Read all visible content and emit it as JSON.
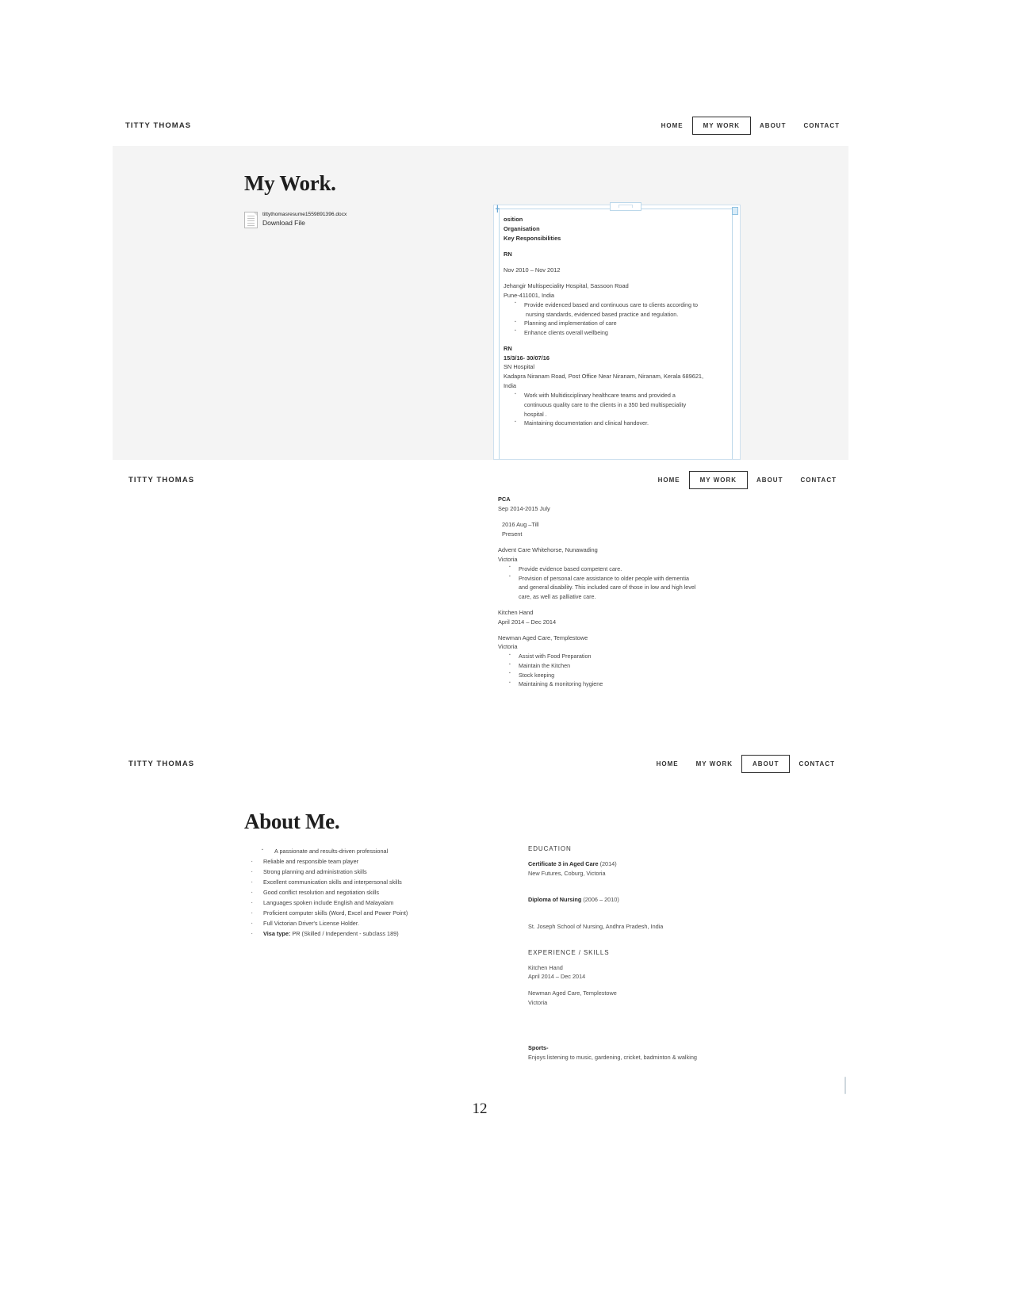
{
  "page": {
    "number": "12"
  },
  "site": {
    "brand": "TITTY THOMAS",
    "nav": [
      {
        "label": "HOME"
      },
      {
        "label": "MY WORK"
      },
      {
        "label": "ABOUT"
      },
      {
        "label": "CONTACT"
      }
    ]
  },
  "section_mywork": {
    "title": "My Work.",
    "file": {
      "name": "tittythomasresume1559891396.docx",
      "action": "Download File",
      "icon": "document-icon"
    },
    "document": {
      "lines": [
        {
          "text": "osition",
          "bold": true
        },
        {
          "text": "Organisation",
          "bold": true
        },
        {
          "text": "Key Responsibilities",
          "bold": true
        },
        {
          "gap": true
        },
        {
          "text": "RN",
          "bold": true
        },
        {
          "gap": true
        },
        {
          "text": "Nov 2010 – Nov 2012"
        },
        {
          "gap": true
        },
        {
          "text": "Jehangir Multispeciality Hospital, Sassoon Road"
        },
        {
          "text": "Pune-411001, India"
        }
      ],
      "bullets_1": [
        "Provide evidenced based and continuous care to clients according to",
        "nursing standards, evidenced based practice and regulation.",
        "Planning and implementation of care",
        "Enhance clients overall wellbeing"
      ],
      "bullets_1_items": [
        {
          "l1": "Provide evidenced based and continuous care to clients according to",
          "l2": "nursing standards, evidenced based practice and regulation."
        },
        {
          "l1": "Planning and implementation of care",
          "l2": ""
        },
        {
          "l1": "Enhance clients overall wellbeing",
          "l2": ""
        }
      ],
      "lines_2": [
        {
          "text": "RN",
          "bold": true
        },
        {
          "text": "15/3/16- 30/07/16",
          "bold": true
        },
        {
          "text": "SN Hospital"
        },
        {
          "text": "Kadapra Niranam Road, Post Office Near Niranam, Niranam, Kerala 689621,"
        },
        {
          "text": "India"
        }
      ],
      "bullets_2_items": [
        {
          "l1": "Work with Multidisciplinary healthcare teams and provided a",
          "l2": "continuous quality care to the clients in a 350 bed multispeciality",
          "l3": "hospital ."
        },
        {
          "l1": "Maintaining documentation and clinical handover.",
          "l2": "",
          "l3": ""
        }
      ]
    }
  },
  "section_work2": {
    "lines": [
      {
        "text": "PCA",
        "bold": true
      },
      {
        "text": "Sep 2014-2015 July"
      },
      {
        "gap": true
      },
      {
        "text": "2016 Aug –Till",
        "indent": true
      },
      {
        "text": "Present",
        "indent": true
      },
      {
        "gap": true
      },
      {
        "text": "Advent Care Whitehorse, Nunawading"
      },
      {
        "text": "Victoria"
      }
    ],
    "bullets_1_items": [
      {
        "l1": "Provide evidence based competent care.",
        "l2": "",
        "l3": ""
      },
      {
        "l1": "Provision of personal care assistance to older people with dementia",
        "l2": "and general disability. This included care of those in low and high level",
        "l3": "care, as well as palliative care."
      }
    ],
    "lines_2": [
      {
        "text": "Kitchen Hand"
      },
      {
        "text": "April  2014 – Dec 2014"
      },
      {
        "gap": true
      },
      {
        "text": "Newman Aged Care, Templestowe"
      },
      {
        "text": "Victoria"
      }
    ],
    "bullets_2_items": [
      "Assist with Food Preparation",
      "Maintain the Kitchen",
      "Stock keeping",
      "Maintaining & monitoring hygiene"
    ]
  },
  "section_about": {
    "title": "About Me.",
    "skills": [
      {
        "text": "A passionate and results-driven professional",
        "first": true
      },
      {
        "text": "Reliable and responsible team player"
      },
      {
        "text": "Strong planning and administration skills"
      },
      {
        "text": "Excellent communication skills and interpersonal skills"
      },
      {
        "text": "Good conflict resolution and negotiation skills"
      },
      {
        "text": "Languages spoken include English and Malayalam"
      },
      {
        "text": "Proficient computer skills (Word, Excel and Power Point)"
      },
      {
        "text": "Full Victorian Driver's License Holder."
      }
    ],
    "visa": {
      "label": "Visa type:",
      "value": " PR (Skilled / Independent - subclass 189)"
    },
    "education": {
      "heading": "EDUCATION",
      "items": [
        {
          "title": "Certificate 3 in Aged Care",
          "year": " (2014)",
          "detail": "New Futures, Coburg, Victoria"
        },
        {
          "title": "Diploma of Nursing",
          "year": " (2006 – 2010)",
          "detail": "St. Joseph School of Nursing, Andhra Pradesh, India"
        }
      ]
    },
    "experience": {
      "heading": "EXPERIENCE / SKILLS",
      "lines": [
        "Kitchen Hand",
        "April  2014 – Dec 2014",
        "",
        "Newman Aged Care, Templestowe",
        "Victoria"
      ]
    },
    "sports": {
      "label": "Sports-",
      "detail": "Enjoys listening to music, gardening, cricket, badminton & walking"
    }
  }
}
